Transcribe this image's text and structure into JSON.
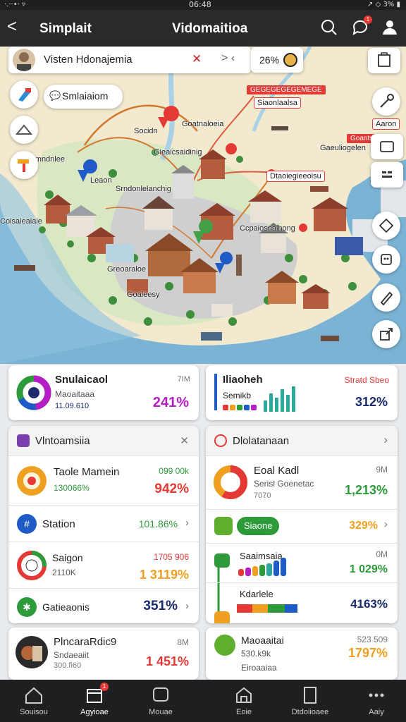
{
  "status": {
    "left": "·.··•· ▿",
    "time": "06:48",
    "right": "↗ ◇ 3% ▮"
  },
  "header": {
    "back_label": "<",
    "title": "Simplait",
    "center_title": "Vidomaitioa",
    "notif_count": "1"
  },
  "search": {
    "text": "Visten Hdonajemia",
    "clear": "✕",
    "nav": "> ‹",
    "percent": "26%"
  },
  "map": {
    "chip_label": "Smlaiaiom",
    "labels": [
      "Goatnaloeia",
      "Gieaicsaidinig",
      "Socidn",
      "Leaon",
      "Srndonlelanchig",
      "Coisaieaiaie",
      "Greoaraloe",
      "Ccpaiosnaihong",
      "Gaeuliogelen",
      "Goaleesy",
      "Simndnlee"
    ],
    "red_tags": [
      "Siaonlaalsa",
      "Dtaoiegieeoisu",
      "Aaron"
    ],
    "red_bars": [
      "GEGEGEGEGEMEGE",
      "Goantsaen"
    ]
  },
  "cards": {
    "simulation": {
      "title": "Snulaicaol",
      "subtitle": "Maoaitaaa",
      "date": "11.09.610",
      "unit": "7IM",
      "value": "241%"
    },
    "market": {
      "title": "Iliaoheh",
      "tag": "Stratd Sbeo",
      "subtitle": "Semikb",
      "value": "312%"
    },
    "left_list": {
      "header": "Vlntoamsiia",
      "close": "✕",
      "rows": [
        {
          "title": "Taole Mamein",
          "sub": "130066%",
          "top": "099 00k",
          "value": "942%"
        },
        {
          "title": "Station",
          "value": "101.86%"
        },
        {
          "title": "Saigon",
          "sub": "2110K",
          "top": "1705 906",
          "value": "1 3119%"
        },
        {
          "title": "Gatieaonis",
          "value": "351%"
        }
      ]
    },
    "right_list": {
      "header": "Dlolatanaan",
      "rows": [
        {
          "title": "Eoal Kadl",
          "sub": "Serisl Goenetac",
          "sub2": "7070",
          "top": "9M",
          "value": "1,213%"
        },
        {
          "pill": "Siaone",
          "value": "329%"
        },
        {
          "title": "Saaimsaia",
          "top": "0M",
          "value": "1 029%"
        },
        {
          "title": "Kdarlele",
          "value": "4163%"
        }
      ]
    },
    "bottom_left": {
      "title": "PlncaraRdic9",
      "sub": "Sndaeaiit",
      "sub2": "300.fi60",
      "top": "8M",
      "value": "1 451%"
    },
    "bottom_right": {
      "title": "Maoaaitai",
      "sub": "530.k9k",
      "sub2": "Eiroaaiaa",
      "top": "523 509",
      "value": "1797%"
    }
  },
  "colors": {
    "accent_red": "#e53935",
    "accent_green": "#2e9b3a",
    "accent_purple": "#b41ec4",
    "navy": "#1a2a6c",
    "orange": "#f0a020"
  },
  "nav": [
    {
      "label": "Souisou",
      "icon": "home-icon"
    },
    {
      "label": "Agyioae",
      "icon": "calendar-icon",
      "badge": "1"
    },
    {
      "label": "Mouae",
      "icon": "chat-icon"
    },
    {
      "label": "Eoie",
      "icon": "store-icon"
    },
    {
      "label": "Dtdoiioaee",
      "icon": "document-icon"
    },
    {
      "label": "Aaiy",
      "icon": "more-icon"
    }
  ]
}
